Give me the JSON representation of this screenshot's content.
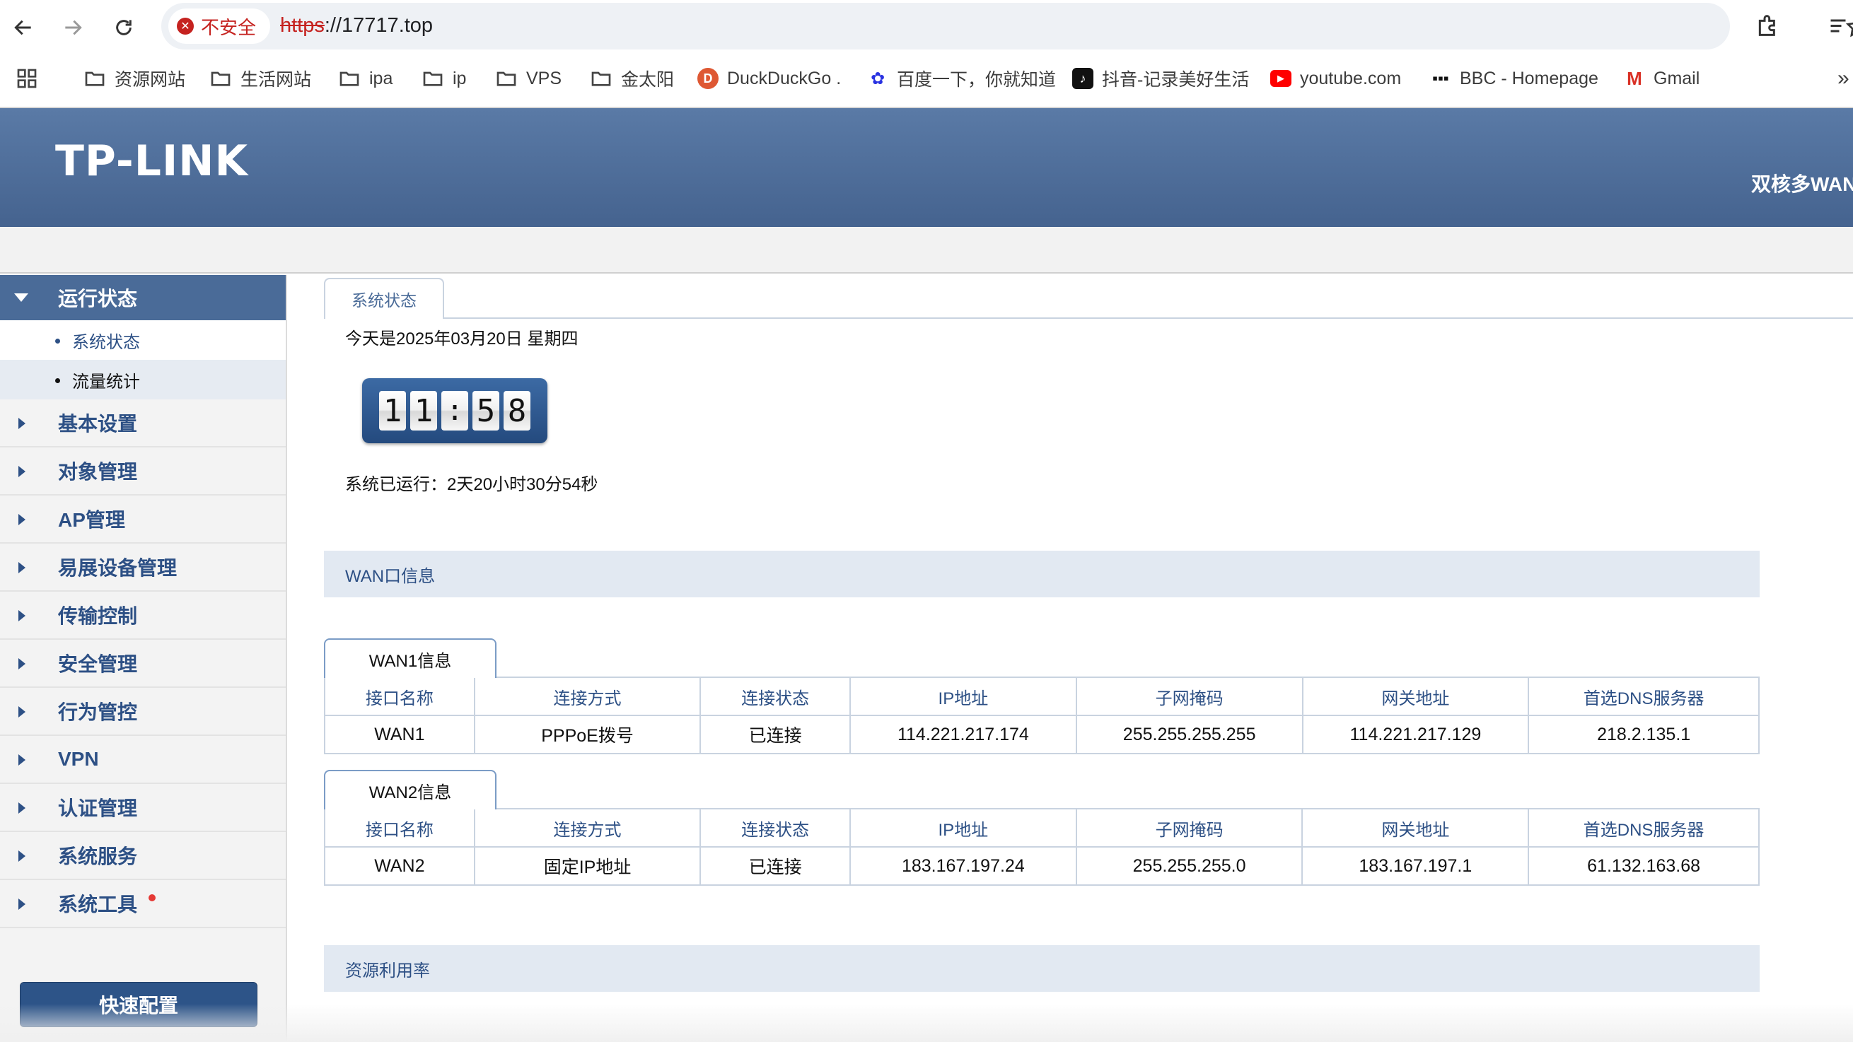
{
  "browser": {
    "security_label": "不安全",
    "url_scheme": "https",
    "url_rest": "://17717.top",
    "bookmarks": [
      {
        "label": "资源网站",
        "icon": "folder-icon"
      },
      {
        "label": "生活网站",
        "icon": "folder-icon"
      },
      {
        "label": "ipa",
        "icon": "folder-icon"
      },
      {
        "label": "ip",
        "icon": "folder-icon"
      },
      {
        "label": "VPS",
        "icon": "folder-icon"
      },
      {
        "label": "金太阳",
        "icon": "folder-icon"
      },
      {
        "label": "DuckDuckGo .",
        "icon": "duckduckgo-icon"
      },
      {
        "label": "百度一下，你就知道",
        "icon": "baidu-icon"
      },
      {
        "label": "抖音-记录美好生活",
        "icon": "douyin-icon"
      },
      {
        "label": "youtube.com",
        "icon": "youtube-icon"
      },
      {
        "label": "BBC - Homepage",
        "icon": "bbc-icon"
      },
      {
        "label": "Gmail",
        "icon": "gmail-icon"
      }
    ],
    "overflow": "»"
  },
  "header": {
    "logo": "TP-LINK",
    "product": "双核多WAN"
  },
  "sidebar": {
    "active_group": "运行状态",
    "sub_items": [
      {
        "label": "系统状态",
        "selected": true
      },
      {
        "label": "流量统计",
        "selected": false
      }
    ],
    "items": [
      {
        "label": "基本设置"
      },
      {
        "label": "对象管理"
      },
      {
        "label": "AP管理"
      },
      {
        "label": "易展设备管理"
      },
      {
        "label": "传输控制"
      },
      {
        "label": "安全管理"
      },
      {
        "label": "行为管控"
      },
      {
        "label": "VPN"
      },
      {
        "label": "认证管理"
      },
      {
        "label": "系统服务"
      },
      {
        "label": "系统工具"
      }
    ],
    "quick_config": "快速配置"
  },
  "main": {
    "tab": "系统状态",
    "today": "今天是2025年03月20日 星期四",
    "clock": {
      "d1": "1",
      "d2": "1",
      "sep": ":",
      "d3": "5",
      "d4": "8"
    },
    "uptime": "系统已运行：2天20小时30分54秒",
    "wan_section": "WAN口信息",
    "columns": [
      "接口名称",
      "连接方式",
      "连接状态",
      "IP地址",
      "子网掩码",
      "网关地址",
      "首选DNS服务器"
    ],
    "wan1": {
      "title": "WAN1信息",
      "row": [
        "WAN1",
        "PPPoE拨号",
        "已连接",
        "114.221.217.174",
        "255.255.255.255",
        "114.221.217.129",
        "218.2.135.1"
      ]
    },
    "wan2": {
      "title": "WAN2信息",
      "row": [
        "WAN2",
        "固定IP地址",
        "已连接",
        "183.167.197.24",
        "255.255.255.0",
        "183.167.197.1",
        "61.132.163.68"
      ]
    },
    "resource_section": "资源利用率"
  },
  "colors": {
    "header": "#4f6f9c",
    "accent": "#2d5085",
    "quick_button": "#2d5488"
  }
}
